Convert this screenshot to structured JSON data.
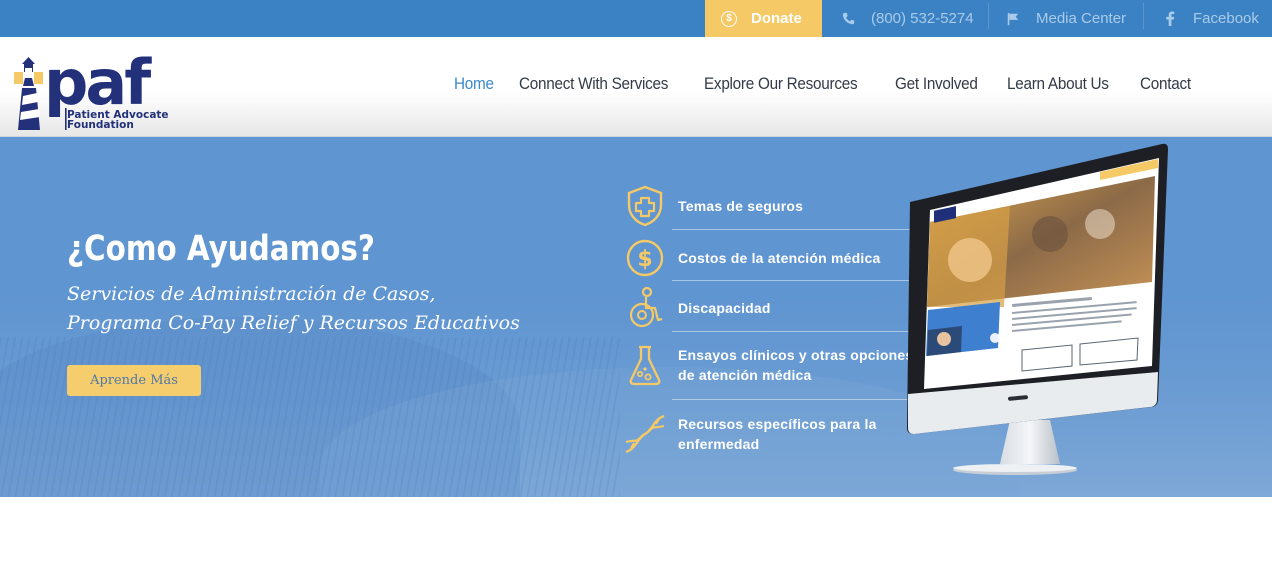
{
  "topbar": {
    "donate_label": "Donate",
    "donate_icon_glyph": "$",
    "phone": "(800) 532-5274",
    "media_center": "Media Center",
    "facebook": "Facebook",
    "icons": {
      "phone": "phone-icon",
      "media": "flag-icon",
      "facebook": "facebook-icon",
      "donate": "dollar-coin-icon"
    }
  },
  "logo": {
    "wordmark": "paf",
    "line1": "Patient Advocate",
    "line2": "Foundation"
  },
  "nav": {
    "items": [
      "Home",
      "Connect With Services",
      "Explore Our Resources",
      "Get Involved",
      "Learn About Us",
      "Contact"
    ],
    "active": "Home"
  },
  "hero": {
    "title": "¿Como Ayudamos?",
    "subtitle_line1": "Servicios de Administración de Casos,",
    "subtitle_line2": "Programa Co-Pay Relief y Recursos Educativos",
    "button_label": "Aprende Más",
    "features": [
      {
        "icon": "shield-plus-icon",
        "line1": "Temas de seguros",
        "line2": ""
      },
      {
        "icon": "dollar-circle-icon",
        "line1": "Costos de la atención médica",
        "line2": ""
      },
      {
        "icon": "wheelchair-icon",
        "line1": "Discapacidad",
        "line2": ""
      },
      {
        "icon": "flask-icon",
        "line1": "Ensayos clínicos y otras opciones",
        "line2": "de atención médica"
      },
      {
        "icon": "dna-icon",
        "line1": "Recursos específicos para la",
        "line2": "enfermedad"
      }
    ]
  },
  "colors": {
    "topbar": "#3b82c4",
    "donate": "#f5c966",
    "accent_yellow": "#f6cd6d",
    "nav_active": "#3b8ac9",
    "hero_blue": "#5f95d1",
    "logo_navy": "#23307a"
  }
}
